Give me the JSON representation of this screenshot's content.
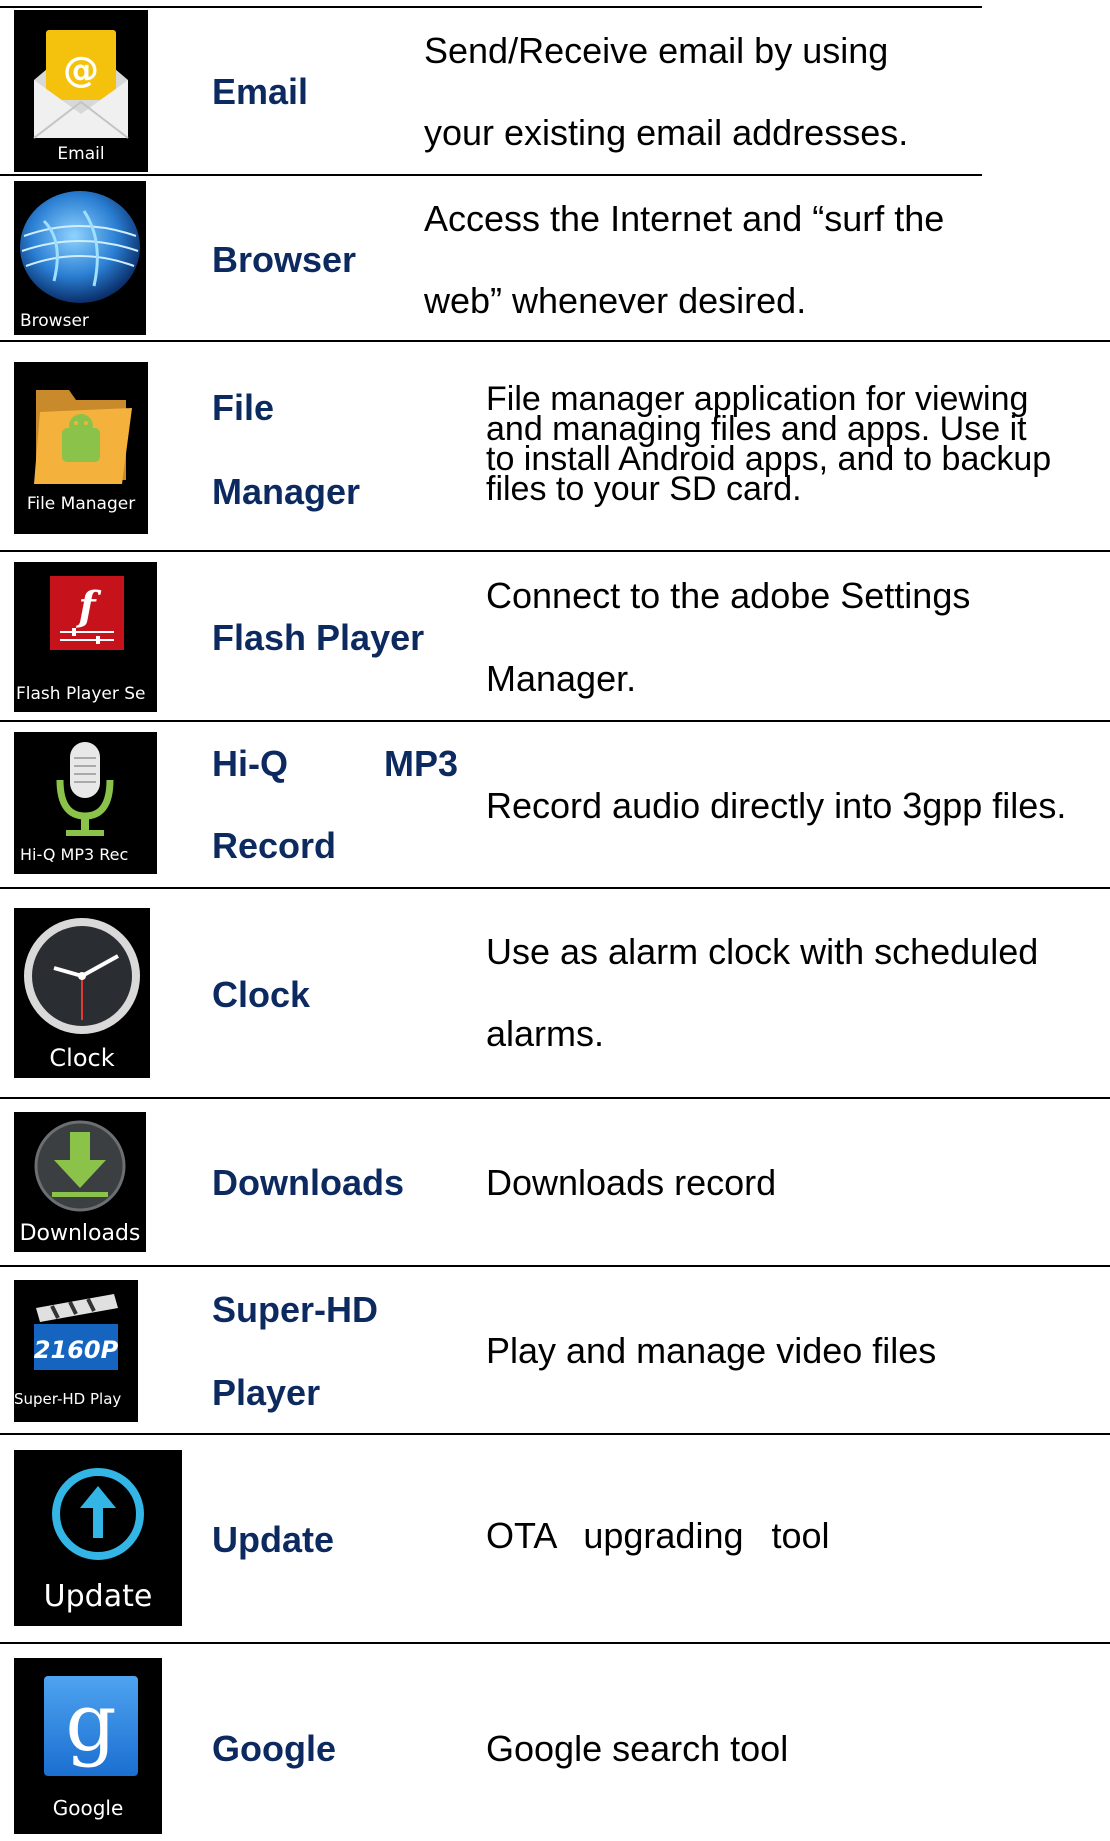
{
  "rows": [
    {
      "icon": "email-icon",
      "caption": "Email",
      "name": [
        "Email"
      ],
      "desc": [
        "Send/Receive email by using",
        "your existing email addresses."
      ]
    },
    {
      "icon": "browser-globe-icon",
      "caption": "Browser",
      "name": [
        "Browser"
      ],
      "desc": [
        "Access the Internet and “surf the",
        "web” whenever desired."
      ]
    },
    {
      "icon": "file-manager-folder-icon",
      "caption": "File Manager",
      "name": [
        "File",
        "Manager"
      ],
      "desc": [
        "File manager application for viewing",
        "and managing files and apps. Use it",
        "to install Android apps, and to backup",
        "files to your SD card."
      ]
    },
    {
      "icon": "flash-player-icon",
      "caption": "Flash Player Se",
      "name": [
        "Flash Player"
      ],
      "desc": [
        "Connect to the adobe Settings",
        "Manager."
      ]
    },
    {
      "icon": "microphone-icon",
      "caption": "Hi-Q MP3 Rec",
      "name": [
        "Hi-Q",
        "MP3",
        "Record"
      ],
      "desc": [
        "Record audio directly into 3gpp files."
      ]
    },
    {
      "icon": "clock-icon",
      "caption": "Clock",
      "name": [
        "Clock"
      ],
      "desc": [
        "Use as alarm clock with scheduled",
        "alarms."
      ]
    },
    {
      "icon": "download-arrow-icon",
      "caption": "Downloads",
      "name": [
        "Downloads"
      ],
      "desc": [
        "Downloads record"
      ]
    },
    {
      "icon": "clapperboard-icon",
      "caption": "Super-HD Play",
      "badge": "2160P",
      "name": [
        "Super-HD",
        "Player"
      ],
      "desc": [
        "Play and manage video files"
      ]
    },
    {
      "icon": "update-arrow-icon",
      "caption": "Update",
      "name": [
        "Update"
      ],
      "desc": [
        "OTA upgrading tool"
      ]
    },
    {
      "icon": "google-g-icon",
      "caption": "Google",
      "name": [
        "Google"
      ],
      "desc": [
        "Google search tool"
      ]
    }
  ]
}
